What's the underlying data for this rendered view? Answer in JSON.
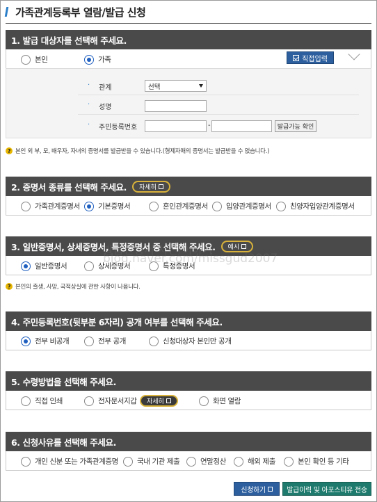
{
  "page_title": "가족관계등록부 열람/발급 신청",
  "colors": {
    "header_bg": "#4a4a4a",
    "accent_blue": "#1f5fbf",
    "button_blue": "#2d5f9e",
    "button_green": "#1d7a6c",
    "pill_border": "#d8b23a"
  },
  "section1": {
    "heading": "1. 발급 대상자를 선택해 주세요.",
    "options": [
      "본인",
      "가족"
    ],
    "selected": "가족",
    "direct_input_button": "직접입력",
    "form": {
      "relation_label": "관계",
      "relation_value": "선택",
      "name_label": "성명",
      "rrn_label": "주민등록번호",
      "dash": "-",
      "check_button": "발급가능 확인"
    },
    "note": "본인 외 부, 모, 배우자, 자녀의 증명서를 발급받을 수 있습니다.(형제자매의 증명서는 발급받을 수 없습니다.)"
  },
  "section2": {
    "heading": "2. 증명서 종류를 선택해 주세요.",
    "detail_button": "자세히",
    "options": [
      "가족관계증명서",
      "기본증명서",
      "혼인관계증명서",
      "입양관계증명서",
      "친양자입양관계증명서"
    ],
    "selected": "기본증명서"
  },
  "section3": {
    "heading": "3. 일반증명서, 상세증명서, 특정증명서 중 선택해 주세요.",
    "example_button": "예시",
    "options": [
      "일반증명서",
      "상세증명서",
      "특정증명서"
    ],
    "selected": "일반증명서",
    "note": "본인의 출생, 사망, 국적상실에 관한 사항이 나옵니다."
  },
  "section4": {
    "heading": "4. 주민등록번호(뒷부분 6자리) 공개 여부를 선택해 주세요.",
    "options": [
      "전부 비공개",
      "전부 공개",
      "신청대상자 본인만 공개"
    ],
    "selected": "전부 비공개"
  },
  "section5": {
    "heading": "5. 수령방법을 선택해 주세요.",
    "options": [
      "직접 인쇄",
      "전자문서지갑",
      "화면 열람"
    ],
    "detail_button": "자세히"
  },
  "section6": {
    "heading": "6. 신청사유를 선택해 주세요.",
    "options": [
      "개인 신분 또는 가족관계증명",
      "국내 기관 제출",
      "연말정산",
      "해외 제출",
      "본인 확인 등 기타"
    ]
  },
  "buttons": {
    "apply": "신청하기",
    "history": "발급이력 및 아포스티유 전송"
  },
  "watermark": {
    "line1": "발급신청서 사진/이야기",
    "line2": "blog.naver.com/missgud2007"
  }
}
